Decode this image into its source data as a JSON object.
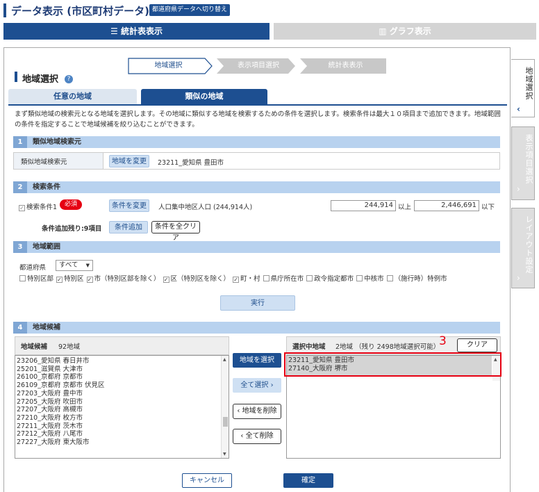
{
  "header": {
    "title": "データ表示 (市区町村データ)",
    "switch_button": "都道府県データへ切り替え"
  },
  "main_tabs": {
    "table": "統計表表示",
    "graph": "グラフ表示"
  },
  "steps": [
    "地域選択",
    "表示項目選択",
    "統計表表示"
  ],
  "side_tabs": [
    "地域選択",
    "表示項目選択",
    "レイアウト設定"
  ],
  "section_title": "地域選択",
  "sub_tabs": {
    "any": "任意の地域",
    "similar": "類似の地域"
  },
  "description": "まず類似地域の検索元となる地域を選択します。その地域に類似する地域を検索するための条件を選択します。検索条件は最大１０項目まで追加できます。地域範囲の条件を指定することで地域候補を絞り込むことができます。",
  "sec1": {
    "num": "1",
    "title": "類似地域検索元",
    "row_label": "類似地域検索元",
    "change_button": "地域を変更",
    "value": "23211_愛知県 豊田市"
  },
  "sec2": {
    "num": "2",
    "title": "検索条件",
    "cond_label": "検索条件1",
    "required": "必須",
    "change_button": "条件を変更",
    "cond_value": "人口集中地区人口 (244,914人)",
    "min": "244,914",
    "min_suffix": "以上",
    "max": "2,446,691",
    "max_suffix": "以下",
    "remaining": "条件追加残り:9項目",
    "add_button": "条件追加",
    "clear_button": "条件を全クリア"
  },
  "sec3": {
    "num": "3",
    "title": "地域範囲",
    "pref_label": "都道府県",
    "pref_value": "すべて",
    "checks": [
      {
        "label": "特別区部",
        "checked": false
      },
      {
        "label": "特別区",
        "checked": true
      },
      {
        "label": "市（特別区部を除く）",
        "checked": true
      },
      {
        "label": "区（特別区を除く）",
        "checked": true
      },
      {
        "label": "町・村",
        "checked": true
      },
      {
        "label": "県庁所在市",
        "checked": false
      },
      {
        "label": "政令指定都市",
        "checked": false
      },
      {
        "label": "中核市",
        "checked": false
      },
      {
        "label": "（施行時）特例市",
        "checked": false
      }
    ],
    "run_button": "実行"
  },
  "sec4": {
    "num": "4",
    "title": "地域候補",
    "cand_title": "地域候補",
    "cand_count": "92地域",
    "candidates": [
      "23206_愛知県 春日井市",
      "25201_滋賀県 大津市",
      "26100_京都府 京都市",
      "26109_京都府 京都市 伏見区",
      "27203_大阪府 豊中市",
      "27205_大阪府 吹田市",
      "27207_大阪府 高槻市",
      "27210_大阪府 枚方市",
      "27211_大阪府 茨木市",
      "27212_大阪府 八尾市",
      "27227_大阪府 東大阪市"
    ],
    "select_button": "地域を選択",
    "select_all_button": "全て選択",
    "remove_button": "地域を削除",
    "remove_all_button": "全て削除",
    "sel_title": "選択中地域",
    "sel_count": "2地域 （残り 2498地域選択可能）",
    "clear_button": "クリア",
    "selected": [
      "23211_愛知県 豊田市",
      "27140_大阪府 堺市"
    ],
    "annotation": "3"
  },
  "footer": {
    "cancel": "キャンセル",
    "ok": "確定"
  },
  "colors": {
    "navy": "#1d4f91",
    "highlight": "#e60012"
  }
}
